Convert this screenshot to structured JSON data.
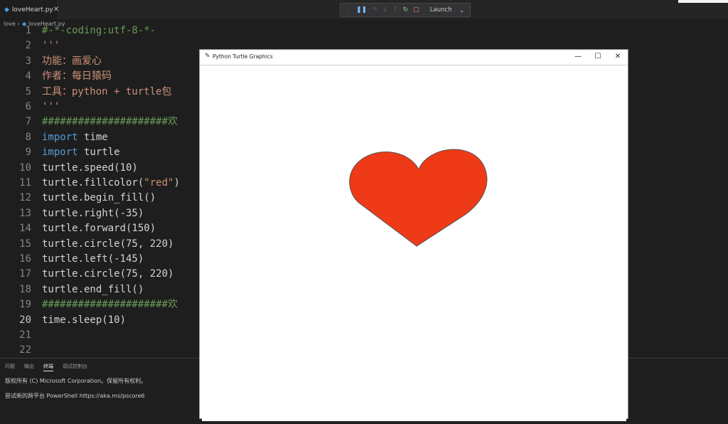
{
  "editor_tab": {
    "filename": "loveHeart.py",
    "close": "✕",
    "icon": "python-file-icon"
  },
  "debug_toolbar": {
    "config_name": "Launch",
    "icons": [
      "drag-grip-icon",
      "pause-icon",
      "step-over-icon",
      "step-into-icon",
      "step-out-icon",
      "restart-icon",
      "stop-icon"
    ]
  },
  "breadcrumb": {
    "folder": "love",
    "file": "loveHeart.py"
  },
  "code_lines": [
    {
      "num": "1",
      "text": "#-*-coding:utf-8-*-"
    },
    {
      "num": "2",
      "text": "'''"
    },
    {
      "num": "3",
      "text": "功能：画爱心"
    },
    {
      "num": "4",
      "text": "作者：每日猿码"
    },
    {
      "num": "5",
      "text": "工具：python + turtle包"
    },
    {
      "num": "6",
      "text": "'''"
    },
    {
      "num": "7",
      "text": "#####################欢"
    },
    {
      "num": "8",
      "kw": "import",
      "rest": " time"
    },
    {
      "num": "9",
      "kw": "import",
      "rest": " turtle"
    },
    {
      "num": "10",
      "text": "turtle.speed(10)"
    },
    {
      "num": "11",
      "pre": "turtle.fillcolor(",
      "str": "\"red\"",
      "post": ")"
    },
    {
      "num": "12",
      "text": "turtle.begin_fill()"
    },
    {
      "num": "13",
      "text": "turtle.right(-35)"
    },
    {
      "num": "14",
      "text": "turtle.forward(150)"
    },
    {
      "num": "15",
      "text": "turtle.circle(75, 220)"
    },
    {
      "num": "16",
      "text": "turtle.left(-145)"
    },
    {
      "num": "17",
      "text": "turtle.circle(75, 220)"
    },
    {
      "num": "18",
      "text": "turtle.end_fill()"
    },
    {
      "num": "19",
      "text": "#####################欢"
    },
    {
      "num": "20",
      "text": "time.sleep(10)"
    },
    {
      "num": "21",
      "text": ""
    },
    {
      "num": "22",
      "text": ""
    }
  ],
  "panel": {
    "tabs": [
      "问题",
      "输出",
      "终端",
      "调试控制台"
    ],
    "active_tab_index": 2,
    "terminal_lines": [
      "版权所有 (C) Microsoft Corporation。保留所有权利。",
      "尝试新的跨平台 PowerShell https://aka.ms/pscore6"
    ]
  },
  "turtle_window": {
    "title": "Python Turtle Graphics",
    "minimize": "—",
    "maximize": "☐",
    "close": "✕",
    "heart_color": "#ee3a16"
  }
}
